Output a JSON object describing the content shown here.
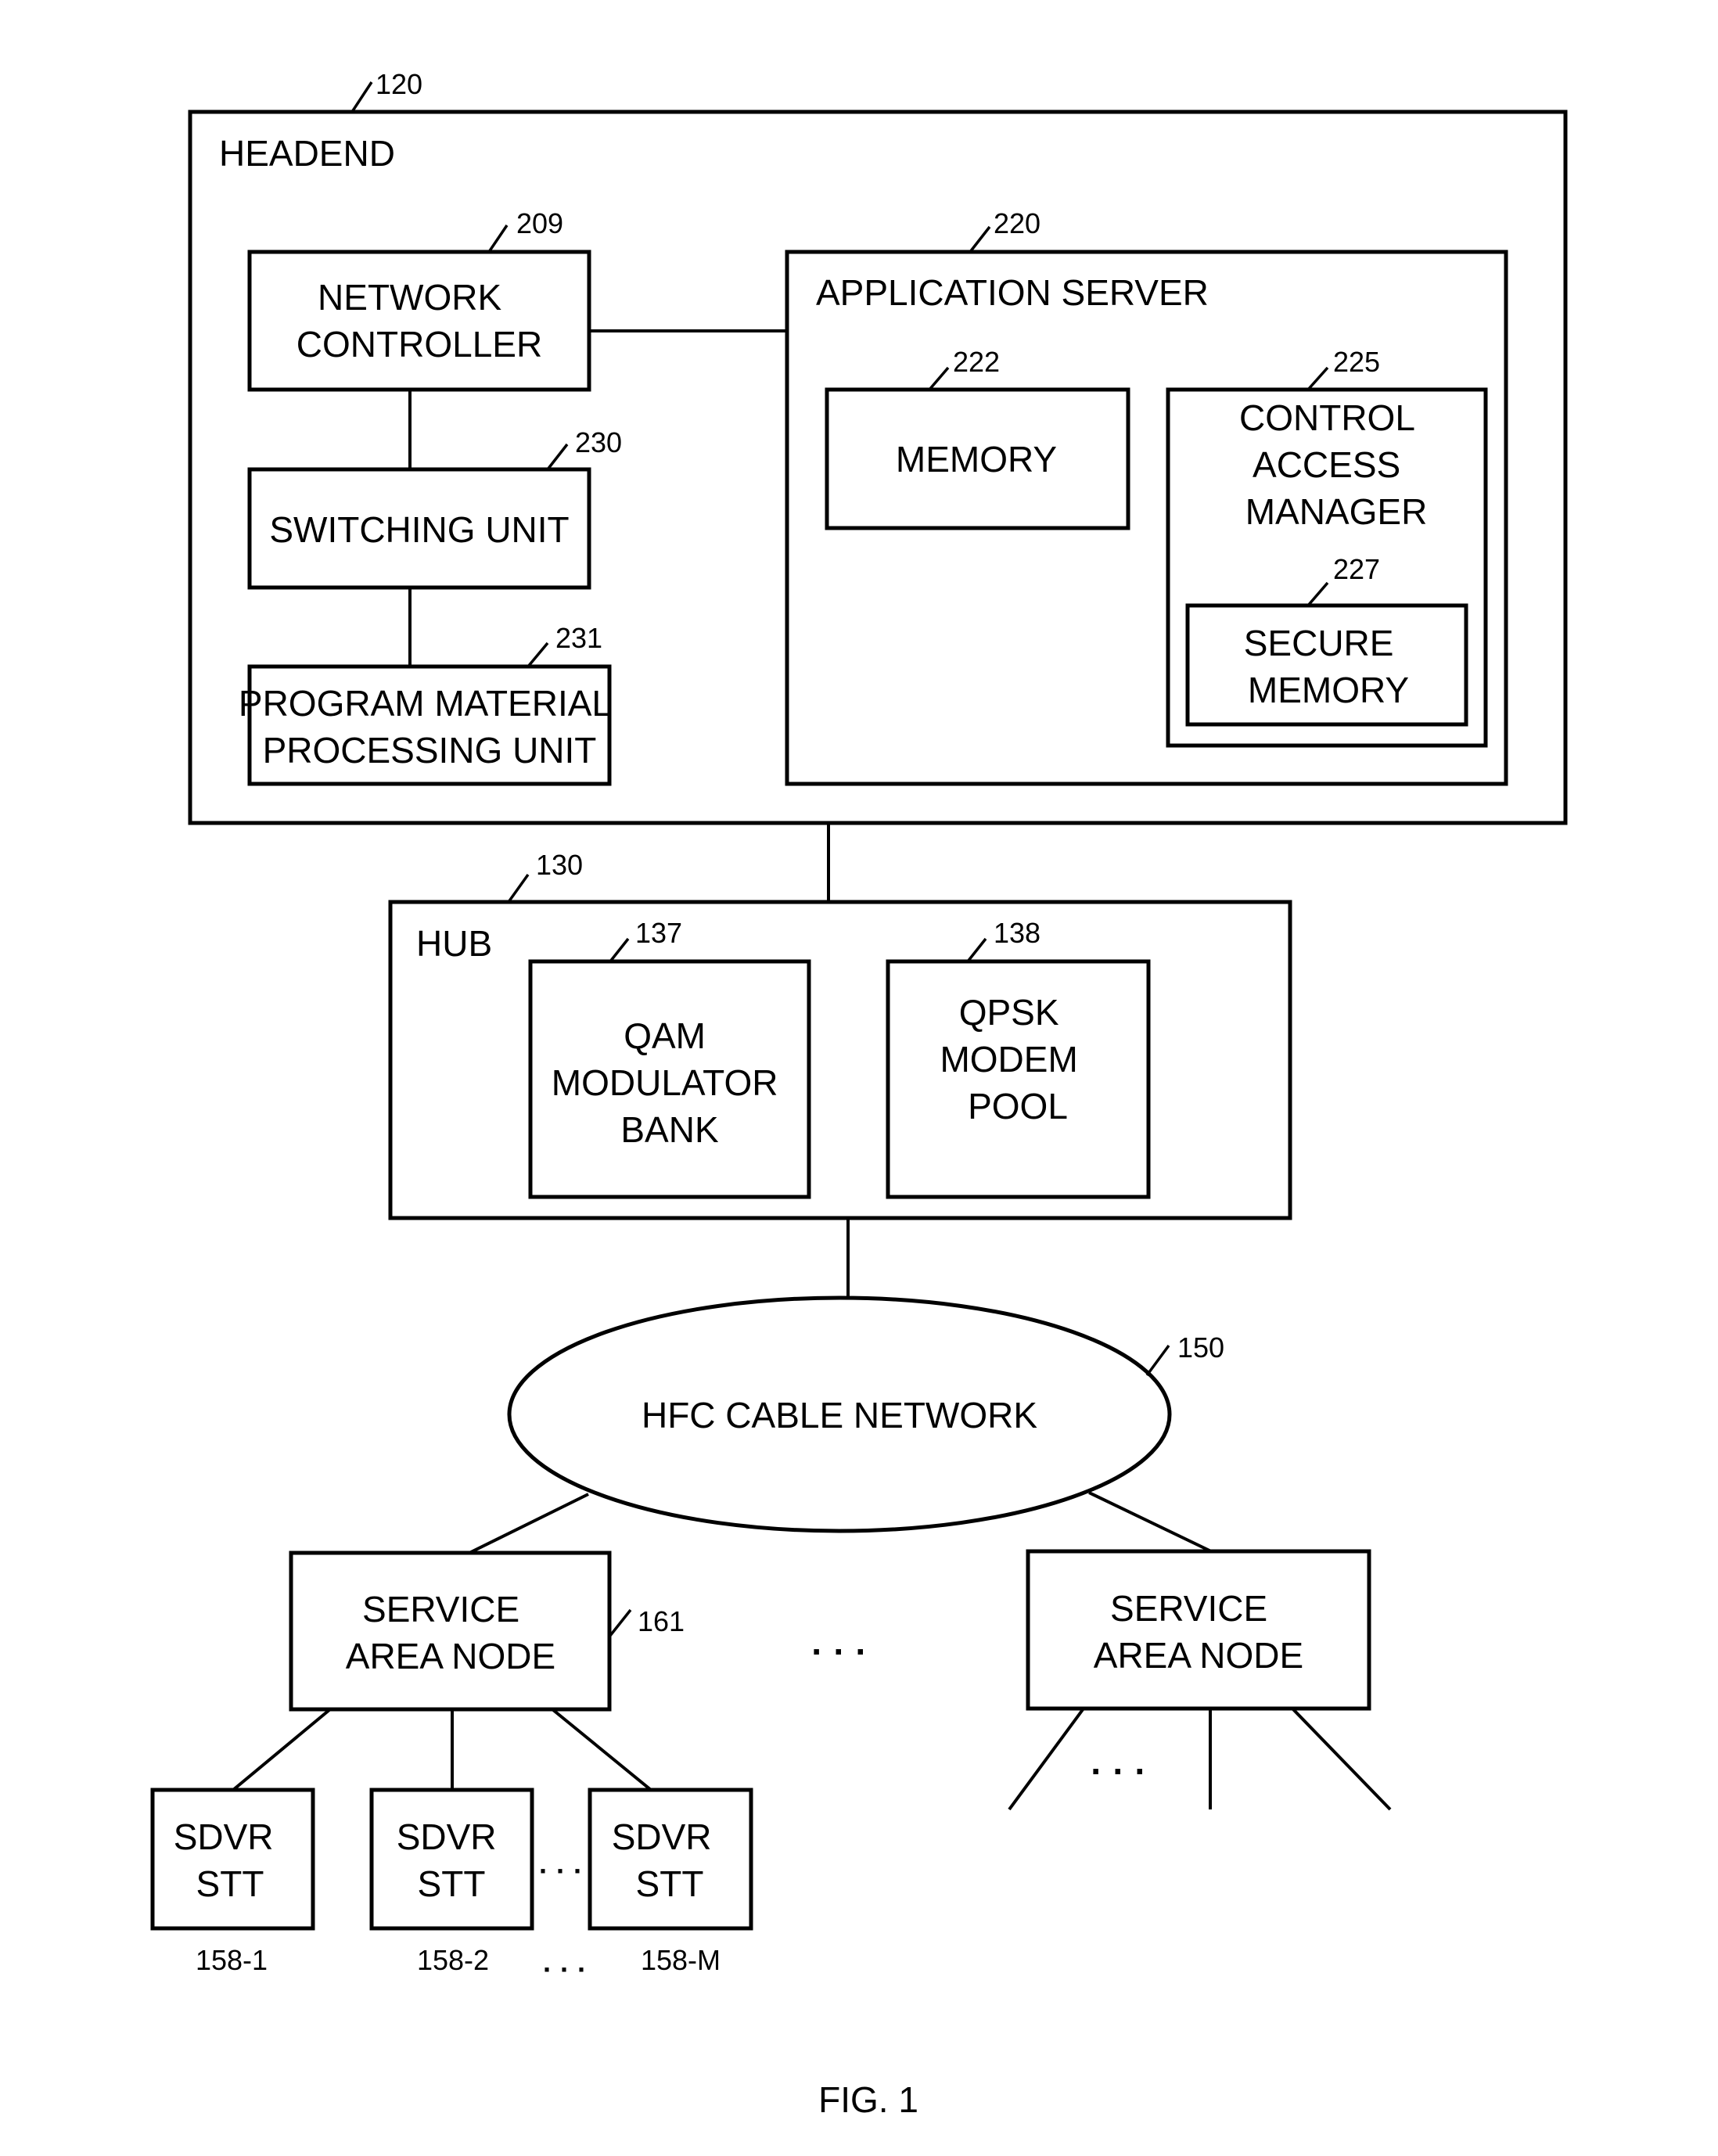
{
  "figure": {
    "caption": "FIG. 1"
  },
  "headend": {
    "ref": "120",
    "label": "HEADEND",
    "network_controller": {
      "ref": "209",
      "lines": [
        "NETWORK",
        "CONTROLLER"
      ]
    },
    "switching_unit": {
      "ref": "230",
      "lines": [
        "SWITCHING UNIT"
      ]
    },
    "program_material_processing_unit": {
      "ref": "231",
      "lines": [
        "PROGRAM MATERIAL",
        "PROCESSING UNIT"
      ]
    },
    "application_server": {
      "ref": "220",
      "label": "APPLICATION SERVER",
      "memory": {
        "ref": "222",
        "lines": [
          "MEMORY"
        ]
      },
      "control_access_manager": {
        "ref": "225",
        "lines": [
          "CONTROL",
          "ACCESS",
          "MANAGER"
        ],
        "secure_memory": {
          "ref": "227",
          "lines": [
            "SECURE",
            "MEMORY"
          ]
        }
      }
    }
  },
  "hub": {
    "ref": "130",
    "label": "HUB",
    "qam_modulator_bank": {
      "ref": "137",
      "lines": [
        "QAM",
        "MODULATOR",
        "BANK"
      ]
    },
    "qpsk_modem_pool": {
      "ref": "138",
      "lines": [
        "QPSK",
        "MODEM",
        "POOL"
      ]
    }
  },
  "hfc_network": {
    "ref": "150",
    "label": "HFC CABLE NETWORK"
  },
  "service_area_nodes": [
    {
      "ref": "161",
      "lines": [
        "SERVICE",
        "AREA NODE"
      ]
    },
    {
      "ref": "",
      "lines": [
        "SERVICE",
        "AREA NODE"
      ]
    }
  ],
  "set_top_terminals": [
    {
      "ref": "158-1",
      "lines": [
        "SDVR",
        "STT"
      ]
    },
    {
      "ref": "158-2",
      "lines": [
        "SDVR",
        "STT"
      ]
    },
    {
      "ref": "158-M",
      "lines": [
        "SDVR",
        "STT"
      ]
    }
  ],
  "ellipsis": "· · ·"
}
